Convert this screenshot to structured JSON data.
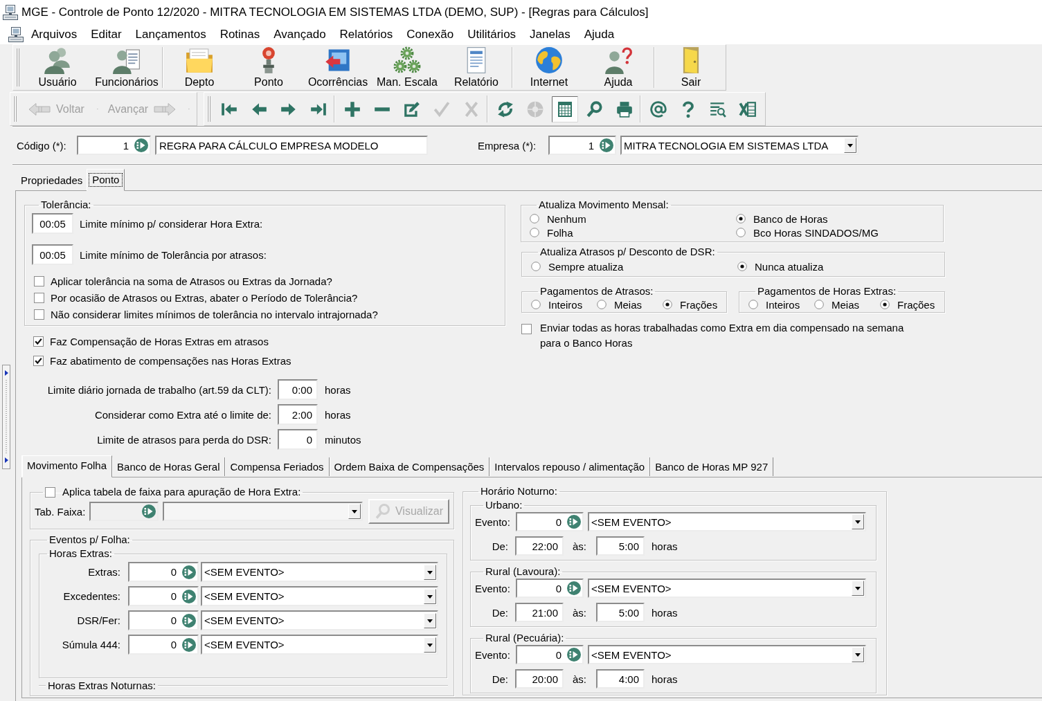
{
  "window": {
    "title": "MGE - Controle de Ponto 12/2020 - MITRA TECNOLOGIA EM SISTEMAS LTDA (DEMO, SUP) - [Regras para Cálculos]"
  },
  "menu": [
    {
      "label": "Arquivos"
    },
    {
      "label": "Editar"
    },
    {
      "label": "Lançamentos"
    },
    {
      "label": "Rotinas"
    },
    {
      "label": "Avançado"
    },
    {
      "label": "Relatórios"
    },
    {
      "label": "Conexão"
    },
    {
      "label": "Utilitários"
    },
    {
      "label": "Janelas"
    },
    {
      "label": "Ajuda"
    }
  ],
  "main_toolbar": {
    "groups": [
      {
        "buttons": [
          {
            "kind": "user",
            "label": "Usuário"
          },
          {
            "kind": "employees",
            "label": "Funcionários"
          }
        ]
      },
      {
        "buttons": [
          {
            "kind": "folder",
            "label": "Depto"
          },
          {
            "kind": "clock",
            "label": "Ponto"
          },
          {
            "kind": "events",
            "label": "Ocorrências"
          },
          {
            "kind": "gears",
            "label": "Man. Escala"
          },
          {
            "kind": "report",
            "label": "Relatório"
          }
        ]
      },
      {
        "buttons": [
          {
            "kind": "globe",
            "label": "Internet"
          },
          {
            "kind": "help",
            "label": "Ajuda"
          }
        ]
      },
      {
        "buttons": [
          {
            "kind": "exit",
            "label": "Sair"
          }
        ]
      }
    ]
  },
  "nav_toolbar": {
    "history": [
      {
        "kind": "back",
        "label": "Voltar",
        "disabled": true
      },
      {
        "kind": "forward",
        "label": "Avançar",
        "disabled": true
      }
    ],
    "groups": [
      {
        "buttons": [
          {
            "kind": "first",
            "disabled": false,
            "pressed": false
          },
          {
            "kind": "previous",
            "disabled": false,
            "pressed": false
          },
          {
            "kind": "next",
            "disabled": false,
            "pressed": false
          },
          {
            "kind": "last",
            "disabled": false,
            "pressed": false
          }
        ]
      },
      {
        "buttons": [
          {
            "kind": "add",
            "disabled": false,
            "pressed": false
          },
          {
            "kind": "remove",
            "disabled": false,
            "pressed": false
          },
          {
            "kind": "edit",
            "disabled": false,
            "pressed": false
          },
          {
            "kind": "confirm",
            "disabled": true,
            "pressed": false
          },
          {
            "kind": "cancel",
            "disabled": true,
            "pressed": false
          }
        ]
      },
      {
        "buttons": [
          {
            "kind": "refresh",
            "disabled": false,
            "pressed": false
          },
          {
            "kind": "stop",
            "disabled": true,
            "pressed": false
          },
          {
            "kind": "grid",
            "disabled": false,
            "pressed": true
          },
          {
            "kind": "search",
            "disabled": false,
            "pressed": false
          },
          {
            "kind": "print",
            "disabled": false,
            "pressed": false
          }
        ]
      },
      {
        "buttons": [
          {
            "kind": "email",
            "disabled": false,
            "pressed": false
          },
          {
            "kind": "help",
            "disabled": false,
            "pressed": false
          },
          {
            "kind": "filter",
            "disabled": false,
            "pressed": false
          },
          {
            "kind": "excel",
            "disabled": false,
            "pressed": false
          }
        ]
      }
    ]
  },
  "header": {
    "code": {
      "label": "Código (*):",
      "number": "1",
      "name": "REGRA PARA CÁLCULO EMPRESA MODELO"
    },
    "company": {
      "label": "Empresa (*):",
      "number": "1",
      "name": "MITRA TECNOLOGIA EM SISTEMAS LTDA"
    }
  },
  "tabs": [
    {
      "label": "Propriedades",
      "selected": false
    },
    {
      "label": "Ponto",
      "selected": true
    }
  ],
  "tolerance": {
    "legend": "Tolerância:",
    "limits": [
      {
        "value": "00:05",
        "label": "Limite mínimo p/ considerar Hora Extra:"
      },
      {
        "value": "00:05",
        "label": "Limite mínimo de Tolerância por atrasos:"
      }
    ],
    "options": [
      {
        "label": "Aplicar tolerância na soma de Atrasos ou Extras da Jornada?",
        "checked": false
      },
      {
        "label": "Por ocasião de Atrasos ou Extras, abater o Período de Tolerância?",
        "checked": false
      },
      {
        "label": "Não considerar limites mínimos de tolerância no intervalo intrajornada?",
        "checked": false
      }
    ]
  },
  "compensation": [
    {
      "label": "Faz Compensação de Horas Extras em atrasos",
      "checked": true
    },
    {
      "label": "Faz abatimento de compensações nas Horas Extras",
      "checked": true
    }
  ],
  "limits": [
    {
      "label": "Limite diário jornada de trabalho (art.59 da CLT):",
      "value": "0:00",
      "unit": "horas"
    },
    {
      "label": "Considerar como Extra até o limite de:",
      "value": "2:00",
      "unit": "horas"
    },
    {
      "label": "Limite de atrasos para perda do DSR:",
      "value": "0",
      "unit": "minutos"
    }
  ],
  "monthly_update": {
    "legend": "Atualiza Movimento Mensal:",
    "options": [
      {
        "label": "Nenhum",
        "selected": false
      },
      {
        "label": "Banco de Horas",
        "selected": true
      },
      {
        "label": "Folha",
        "selected": false
      },
      {
        "label": "Bco Horas SINDADOS/MG",
        "selected": false
      }
    ]
  },
  "dsr_update": {
    "legend": "Atualiza Atrasos p/ Desconto de DSR:",
    "options": [
      {
        "label": "Sempre atualiza",
        "selected": false
      },
      {
        "label": "Nunca atualiza",
        "selected": true
      }
    ]
  },
  "payments": [
    {
      "legend": "Pagamentos de Atrasos:",
      "options": [
        {
          "label": "Inteiros",
          "selected": false
        },
        {
          "label": "Meias",
          "selected": false
        },
        {
          "label": "Frações",
          "selected": true
        }
      ]
    },
    {
      "legend": "Pagamentos de Horas Extras:",
      "options": [
        {
          "label": "Inteiros",
          "selected": false
        },
        {
          "label": "Meias",
          "selected": false
        },
        {
          "label": "Frações",
          "selected": true
        }
      ]
    }
  ],
  "send_all": {
    "label": "Enviar todas as horas trabalhadas como Extra em dia compensado na semana para o Banco Horas",
    "checked": false
  },
  "sub_tabs": [
    {
      "label": "Movimento Folha",
      "selected": true
    },
    {
      "label": "Banco de Horas Geral",
      "selected": false
    },
    {
      "label": "Compensa Feriados",
      "selected": false
    },
    {
      "label": "Ordem Baixa de Compensações",
      "selected": false
    },
    {
      "label": "Intervalos repouso / alimentação",
      "selected": false
    },
    {
      "label": "Banco de Horas MP 927",
      "selected": false
    }
  ],
  "band_table": {
    "legend": "Aplica tabela de faixa para apuração de Hora Extra:",
    "checked": false,
    "field_label": "Tab. Faixa:",
    "disabled": true,
    "button": "Visualizar"
  },
  "payroll_events": {
    "legend": "Eventos p/ Folha:",
    "overtime": {
      "legend": "Horas Extras:",
      "rows": [
        {
          "label": "Extras:",
          "number": "0",
          "event": "<SEM EVENTO>"
        },
        {
          "label": "Excedentes:",
          "number": "0",
          "event": "<SEM EVENTO>"
        },
        {
          "label": "DSR/Fer:",
          "number": "0",
          "event": "<SEM EVENTO>"
        },
        {
          "label": "Súmula 444:",
          "number": "0",
          "event": "<SEM EVENTO>"
        }
      ]
    },
    "night_overtime": {
      "legend": "Horas Extras Noturnas:"
    }
  },
  "night_hours": {
    "legend": "Horário Noturno:",
    "groups": [
      {
        "legend": "Urbano:",
        "event_label": "Evento:",
        "number": "0",
        "event": "<SEM EVENTO>",
        "from_label": "De:",
        "from": "22:00",
        "to_label": "às:",
        "to": "5:00",
        "unit": "horas"
      },
      {
        "legend": "Rural (Lavoura):",
        "event_label": "Evento:",
        "number": "0",
        "event": "<SEM EVENTO>",
        "from_label": "De:",
        "from": "21:00",
        "to_label": "às:",
        "to": "5:00",
        "unit": "horas"
      },
      {
        "legend": "Rural (Pecuária):",
        "event_label": "Evento:",
        "number": "0",
        "event": "<SEM EVENTO>",
        "from_label": "De:",
        "from": "20:00",
        "to_label": "às:",
        "to": "4:00",
        "unit": "horas"
      }
    ]
  }
}
